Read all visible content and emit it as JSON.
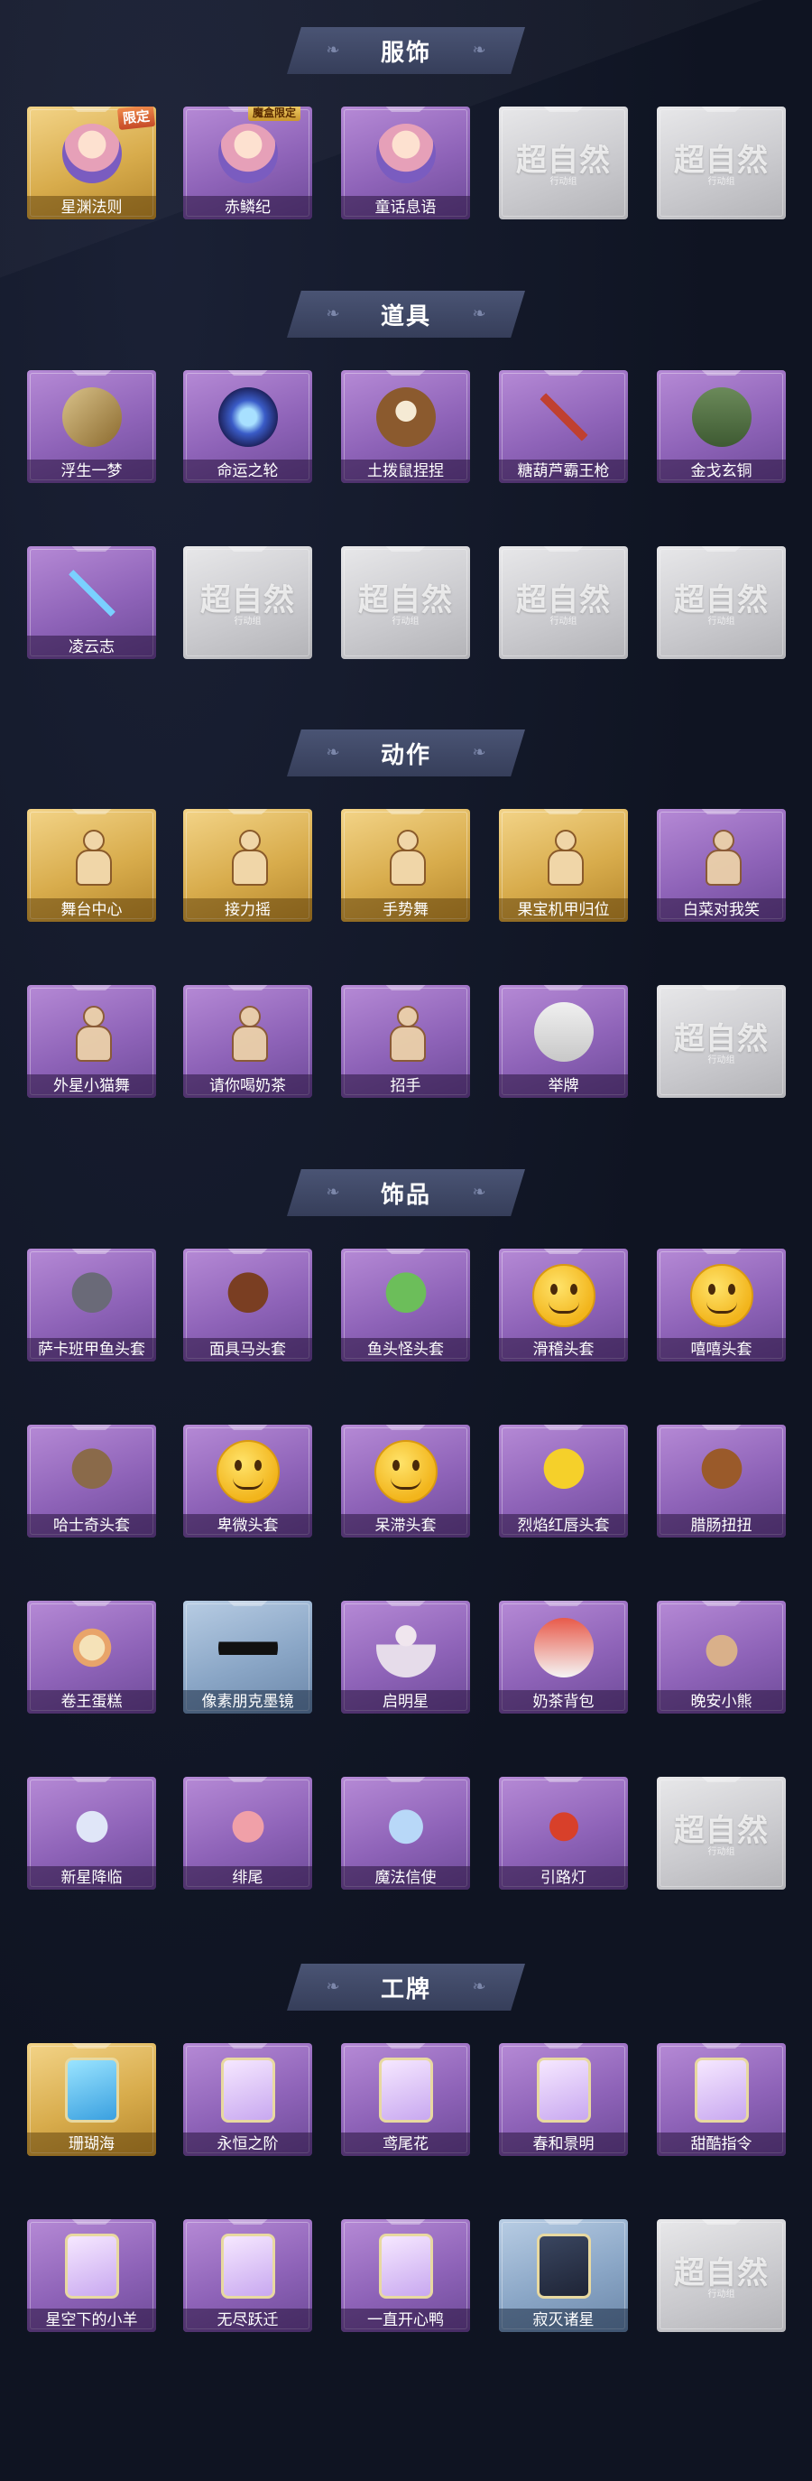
{
  "colors": {
    "background": "#0f1422",
    "banner": "#3d4664",
    "purple_card": "#8e63b8",
    "gold_card": "#d8ac4c",
    "blue_card": "#8aa6c6",
    "empty_card": "#c9c9cd"
  },
  "watermark": {
    "main": "超自然",
    "sub": "行动组"
  },
  "sections": [
    {
      "title": "服饰",
      "items": [
        {
          "label": "星渊法则",
          "rarity": "gold",
          "icon": "character-portrait-icon",
          "badge": "限定"
        },
        {
          "label": "赤鳞纪",
          "rarity": "purple",
          "icon": "character-portrait-icon",
          "badge": "魔盒限定"
        },
        {
          "label": "童话息语",
          "rarity": "purple",
          "icon": "character-portrait-icon"
        },
        {
          "label": "",
          "rarity": "empty"
        },
        {
          "label": "",
          "rarity": "empty"
        }
      ]
    },
    {
      "title": "道具",
      "items": [
        {
          "label": "浮生一梦",
          "rarity": "purple",
          "icon": "scroll-icon"
        },
        {
          "label": "命运之轮",
          "rarity": "purple",
          "icon": "orb-icon"
        },
        {
          "label": "土拨鼠捏捏",
          "rarity": "purple",
          "icon": "groundhog-toy-icon"
        },
        {
          "label": "糖葫芦霸王枪",
          "rarity": "purple",
          "icon": "spear-icon"
        },
        {
          "label": "金戈玄铜",
          "rarity": "purple",
          "icon": "lantern-icon"
        },
        {
          "label": "凌云志",
          "rarity": "purple",
          "icon": "sword-icon"
        },
        {
          "label": "",
          "rarity": "empty"
        },
        {
          "label": "",
          "rarity": "empty"
        },
        {
          "label": "",
          "rarity": "empty"
        },
        {
          "label": "",
          "rarity": "empty"
        }
      ]
    },
    {
      "title": "动作",
      "items": [
        {
          "label": "舞台中心",
          "rarity": "gold",
          "icon": "pose-icon"
        },
        {
          "label": "接力摇",
          "rarity": "gold",
          "icon": "pose-icon"
        },
        {
          "label": "手势舞",
          "rarity": "gold",
          "icon": "pose-icon"
        },
        {
          "label": "果宝机甲归位",
          "rarity": "gold",
          "icon": "pose-icon"
        },
        {
          "label": "白菜对我笑",
          "rarity": "purple",
          "icon": "pose-icon"
        },
        {
          "label": "外星小猫舞",
          "rarity": "purple",
          "icon": "pose-icon"
        },
        {
          "label": "请你喝奶茶",
          "rarity": "purple",
          "icon": "pose-icon"
        },
        {
          "label": "招手",
          "rarity": "purple",
          "icon": "pose-icon"
        },
        {
          "label": "举牌",
          "rarity": "purple",
          "icon": "sign-icon"
        },
        {
          "label": "",
          "rarity": "empty"
        }
      ]
    },
    {
      "title": "饰品",
      "items": [
        {
          "label": "萨卡班甲鱼头套",
          "rarity": "purple",
          "icon": "fish-head-icon"
        },
        {
          "label": "面具马头套",
          "rarity": "purple",
          "icon": "horse-mask-icon"
        },
        {
          "label": "鱼头怪头套",
          "rarity": "purple",
          "icon": "frog-head-icon"
        },
        {
          "label": "滑稽头套",
          "rarity": "purple",
          "icon": "smiley-icon"
        },
        {
          "label": "嘻嘻头套",
          "rarity": "purple",
          "icon": "grin-icon"
        },
        {
          "label": "哈士奇头套",
          "rarity": "purple",
          "icon": "husky-icon"
        },
        {
          "label": "卑微头套",
          "rarity": "purple",
          "icon": "sad-face-icon"
        },
        {
          "label": "呆滞头套",
          "rarity": "purple",
          "icon": "stare-face-icon"
        },
        {
          "label": "烈焰红唇头套",
          "rarity": "purple",
          "icon": "pikachu-icon"
        },
        {
          "label": "腊肠扭扭",
          "rarity": "purple",
          "icon": "dachshund-icon"
        },
        {
          "label": "卷王蛋糕",
          "rarity": "purple",
          "icon": "cake-roll-icon"
        },
        {
          "label": "像素朋克墨镜",
          "rarity": "blue",
          "icon": "pixel-sunglasses-icon"
        },
        {
          "label": "启明星",
          "rarity": "purple",
          "icon": "mannequin-icon"
        },
        {
          "label": "奶茶背包",
          "rarity": "purple",
          "icon": "backpack-icon"
        },
        {
          "label": "晚安小熊",
          "rarity": "purple",
          "icon": "bear-charm-icon"
        },
        {
          "label": "新星降临",
          "rarity": "purple",
          "icon": "charm-icon"
        },
        {
          "label": "绯尾",
          "rarity": "purple",
          "icon": "fox-charm-icon"
        },
        {
          "label": "魔法信使",
          "rarity": "purple",
          "icon": "elephant-charm-icon"
        },
        {
          "label": "引路灯",
          "rarity": "purple",
          "icon": "lantern-charm-icon"
        },
        {
          "label": "",
          "rarity": "empty"
        }
      ]
    },
    {
      "title": "工牌",
      "items": [
        {
          "label": "珊瑚海",
          "rarity": "gold",
          "icon": "badge-card-icon"
        },
        {
          "label": "永恒之阶",
          "rarity": "purple",
          "icon": "badge-card-icon"
        },
        {
          "label": "鸢尾花",
          "rarity": "purple",
          "icon": "badge-card-icon"
        },
        {
          "label": "春和景明",
          "rarity": "purple",
          "icon": "badge-card-icon"
        },
        {
          "label": "甜酷指令",
          "rarity": "purple",
          "icon": "badge-card-icon"
        },
        {
          "label": "星空下的小羊",
          "rarity": "purple",
          "icon": "badge-card-icon"
        },
        {
          "label": "无尽跃迁",
          "rarity": "purple",
          "icon": "badge-card-icon"
        },
        {
          "label": "一直开心鸭",
          "rarity": "purple",
          "icon": "badge-card-icon"
        },
        {
          "label": "寂灭诸星",
          "rarity": "blue",
          "icon": "badge-card-icon"
        },
        {
          "label": "",
          "rarity": "empty"
        }
      ]
    }
  ]
}
